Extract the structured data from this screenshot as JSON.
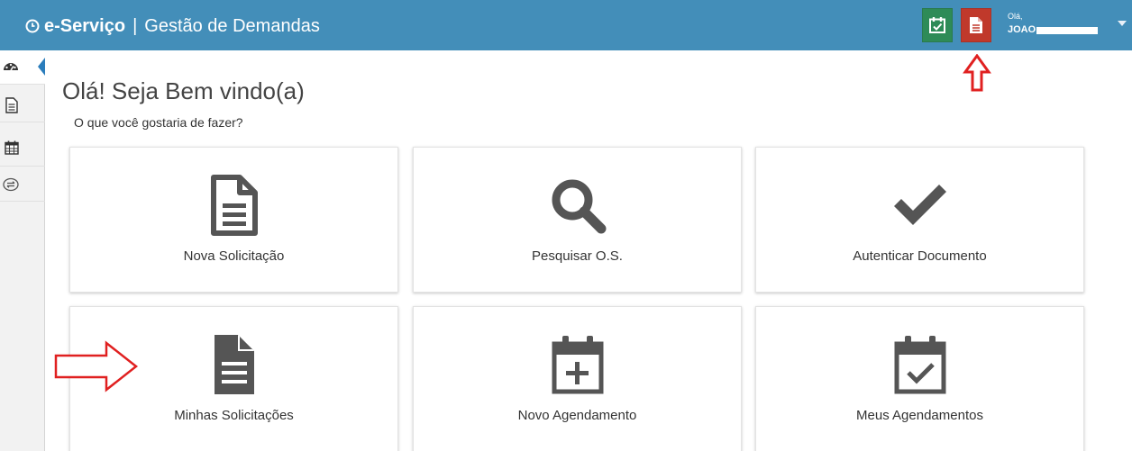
{
  "header": {
    "brand_name": "e-Serviço",
    "separator": "|",
    "app_title": "Gestão de Demandas",
    "user_greeting": "Olá,",
    "user_name": "JOAO"
  },
  "sidebar": {
    "items": [
      {
        "icon": "dashboard-icon",
        "active": true
      },
      {
        "icon": "document-icon",
        "active": false
      },
      {
        "icon": "calendar-icon",
        "active": false
      },
      {
        "icon": "exchange-icon",
        "active": false
      }
    ]
  },
  "main": {
    "welcome": "Olá! Seja Bem vindo(a)",
    "subtitle": "O que você gostaria de fazer?",
    "cards": [
      {
        "label": "Nova Solicitação",
        "icon": "new-document-icon"
      },
      {
        "label": "Pesquisar O.S.",
        "icon": "search-icon"
      },
      {
        "label": "Autenticar Documento",
        "icon": "check-icon"
      },
      {
        "label": "Minhas Solicitações",
        "icon": "file-text-icon"
      },
      {
        "label": "Novo Agendamento",
        "icon": "calendar-plus-icon"
      },
      {
        "label": "Meus Agendamentos",
        "icon": "calendar-check-icon"
      }
    ]
  },
  "colors": {
    "topbar": "#438eb9",
    "green_button": "#2e8b57",
    "red_button": "#c0392b",
    "icon_gray": "#555555",
    "annotation_red": "#e02020"
  }
}
